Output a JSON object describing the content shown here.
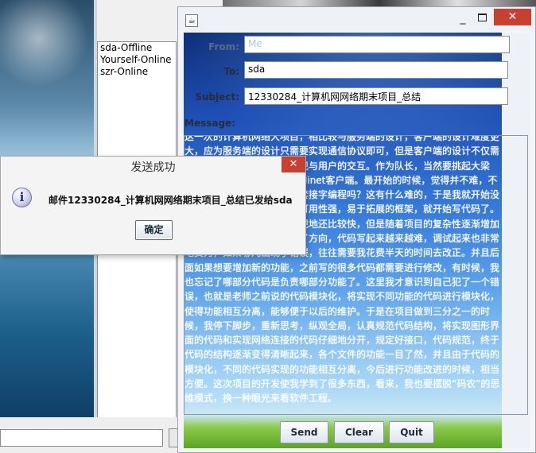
{
  "background_chat": {
    "users": [
      "sda-Offline",
      "Yourself-Online",
      "szr-Online"
    ]
  },
  "mail_window": {
    "icon": "java-app-icon",
    "minimize_symbol": "_",
    "close_symbol": "✕",
    "from_label": "From:",
    "from_value": "Me",
    "to_label": "To:",
    "to_value": "sda",
    "subject_label": "Subject:",
    "subject_value": "12330284_计算机网网络期末项目_总结",
    "message_label": "Message:",
    "message_body": "这一次的计算机网络大项目，相比较与服务端的设计，客户端的设计难度更大，应为服务端的设计只需要实现通信协议即可，但是客户端的设计不仅需要实现通信协议，还需要实现与用户的交互。作为队长，当然要挑起大梁了，我一开始的想法是实现Minet客户端。最开始的时候，觉得并不难，不就是在图形界面再加上网络套接字编程吗？这有什么难的，于是我就开始没有仔细地去思考和设计一个可用性强，易于拓展的框架，就开始写代码了。不错，刚开始的时候代码实现地还比较快，但是随着项目的复杂性逐渐增加起来了，我更开始慢慢地失了方向，代码写起来越来越难，调试起来也非常地费力，如果哪儿出现了错误，往往需要我花费半天的时间去改正。并且后面如果想要增加新的功能，之前写的很多代码都需要进行修改，有时候，我也忘记了哪部分代码是负责哪部分功能了。这里我才意识到自己犯了一个错误，也就是老师之前说的代码模块化，将实现不同功能的代码进行模块化，使得功能相互分离，能够便于以后的维护。于是在项目做到三分之一的时候，我停下脚步，重新思考，纵观全局，认真规范代码结构，将实现图形界面的代码和实现网络连接的代码仔细地分开，规定好接口，代码规范，终于代码的结构逐渐变得清晰起来，各个文件的功能一目了然，并且由于代码的模块化，不同的代码实现的功能相互分离，今后进行功能改进的时候，相当方便。这次项目的开发使我学到了很多东西，看来，我也要摆脱“码农”的思维模式，换一种眼光来看软件工程。",
    "buttons": {
      "send": "Send",
      "clear": "Clear",
      "quit": "Quit"
    }
  },
  "dialog": {
    "title": "发送成功",
    "close_symbol": "✕",
    "icon": "info-icon",
    "icon_glyph": "i",
    "message": "邮件12330284_计算机网网络期末项目_总结已发给sda",
    "ok_label": "确定"
  }
}
